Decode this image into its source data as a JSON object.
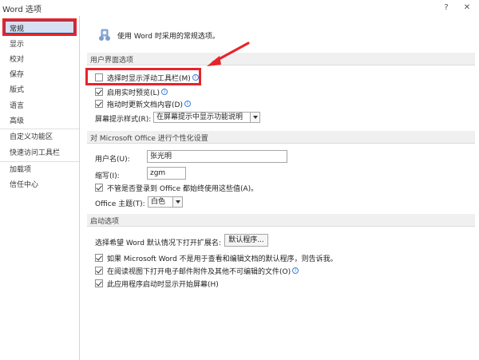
{
  "window": {
    "title": "Word 选项",
    "help_glyph": "?",
    "close_glyph": "✕"
  },
  "sidebar": {
    "items": [
      {
        "label": "常规"
      },
      {
        "label": "显示"
      },
      {
        "label": "校对"
      },
      {
        "label": "保存"
      },
      {
        "label": "版式"
      },
      {
        "label": "语言"
      },
      {
        "label": "高级"
      },
      {
        "label": "自定义功能区"
      },
      {
        "label": "快速访问工具栏"
      },
      {
        "label": "加载项"
      },
      {
        "label": "信任中心"
      }
    ]
  },
  "main": {
    "header": "使用 Word 时采用的常规选项。",
    "ui_section": {
      "title": "用户界面选项",
      "mini_toolbar": {
        "label": "选择时显示浮动工具栏(M)",
        "checked": false
      },
      "live_preview": {
        "label": "启用实时预览(L)",
        "checked": true
      },
      "live_update": {
        "label": "拖动时更新文档内容(D)",
        "checked": true
      },
      "screentip_label": "屏幕提示样式(R):",
      "screentip_value": "在屏幕提示中显示功能说明"
    },
    "personalize_section": {
      "title": "对 Microsoft Office 进行个性化设置",
      "username_label": "用户名(U):",
      "username_value": "张光明",
      "initials_label": "缩写(I):",
      "initials_value": "zgm",
      "always_use": {
        "label": "不管是否登录到 Office 都始终使用这些值(A)。",
        "checked": true
      },
      "theme_label": "Office 主题(T):",
      "theme_value": "白色"
    },
    "startup_section": {
      "title": "启动选项",
      "default_ext_label": "选择希望 Word 默认情况下打开扩展名:",
      "default_programs_button": "默认程序...",
      "tell_me": {
        "label": "如果 Microsoft Word 不是用于查看和编辑文档的默认程序，则告诉我。",
        "checked": true
      },
      "reading_view": {
        "label": "在阅读视图下打开电子邮件附件及其他不可编辑的文件(O)",
        "checked": true
      },
      "start_screen": {
        "label": "此应用程序启动时显示开始屏幕(H)",
        "checked": true
      }
    }
  },
  "colors": {
    "highlight": "#e8232a",
    "selected_bg": "#d5e1f2",
    "accent": "#2b579a"
  }
}
